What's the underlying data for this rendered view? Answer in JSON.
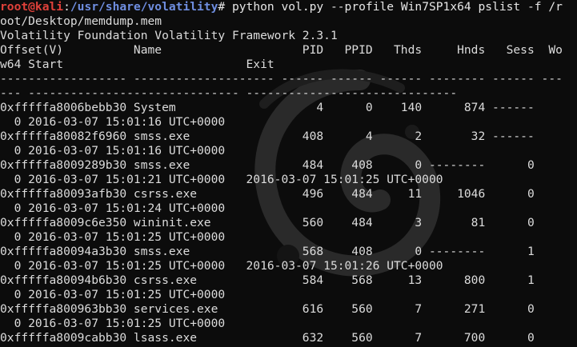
{
  "prompt": {
    "user_host": "root@kali",
    "sep": ":",
    "path": "/usr/share/volatility",
    "symbol": "# ",
    "command_first": "python vol.py --profile Win7SP1x64 pslist -f /r",
    "command_wrap": "oot/Desktop/memdump.mem"
  },
  "banner": "Volatility Foundation Volatility Framework 2.3.1",
  "header": {
    "line1": "Offset(V)          Name                    PID   PPID   Thds     Hnds   Sess  Wo",
    "line2": "w64 Start                          Exit",
    "sep1": "------------------ -------------------- ------ ------ ------ -------- ------ ---",
    "sep2": "--- ------------------------------ ------------------------------"
  },
  "rows": [
    "0xfffffa8006bebb30 System                    4      0    140      874 ------",
    "  0 2016-03-07 15:01:16 UTC+0000",
    "0xfffffa80082f6960 smss.exe                408      4      2       32 ------",
    "  0 2016-03-07 15:01:16 UTC+0000",
    "0xfffffa8009289b30 smss.exe                484    408      0 --------      0",
    "  0 2016-03-07 15:01:21 UTC+0000   2016-03-07 15:01:25 UTC+0000",
    "0xfffffa80093afb30 csrss.exe               496    484     11     1046      0",
    "  0 2016-03-07 15:01:24 UTC+0000",
    "0xfffffa8009c6e350 wininit.exe             560    484      3       81      0",
    "  0 2016-03-07 15:01:25 UTC+0000",
    "0xfffffa80094a3b30 smss.exe                568    408      0 --------      1",
    "  0 2016-03-07 15:01:25 UTC+0000   2016-03-07 15:01:26 UTC+0000",
    "0xfffffa80094b6b30 csrss.exe               584    568     13      800      1",
    "  0 2016-03-07 15:01:25 UTC+0000",
    "0xfffffa800963bb30 services.exe            616    560      7      271      0",
    "  0 2016-03-07 15:01:25 UTC+0000",
    "0xfffffa8009cabb30 lsass.exe               632    560      7      700      0"
  ],
  "colors": {
    "background": "#0c0c0c",
    "text": "#dcdcdc",
    "prompt_user": "#e0413a",
    "prompt_path": "#6f8ee0"
  },
  "icons": {
    "background_logo": "debian-swirl-icon"
  }
}
